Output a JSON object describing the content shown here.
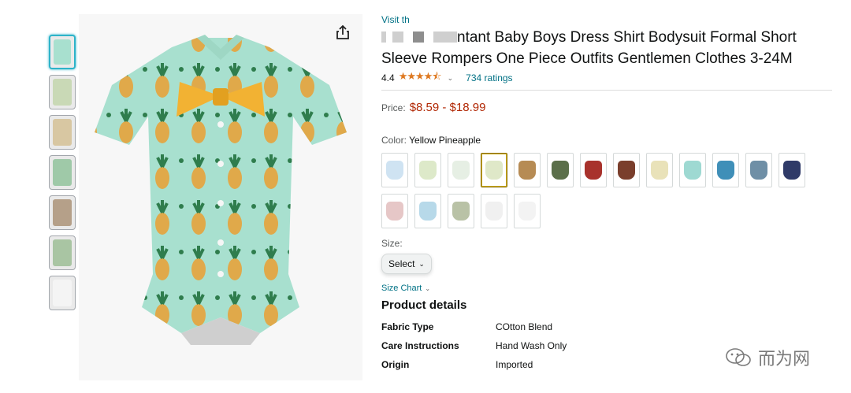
{
  "header": {
    "visit_link": "Visit th",
    "title_rest": "ntant Baby Boys Dress Shirt Bodysuit Formal Short Sleeve Rompers One Piece Outfits Gentlemen Clothes 3-24M"
  },
  "rating": {
    "value": "4.4",
    "stars": "★★★★⯪",
    "count": "734 ratings"
  },
  "price": {
    "label": "Price:",
    "value": "$8.59 - $18.99"
  },
  "color": {
    "label": "Color: ",
    "selected": "Yellow Pineapple",
    "swatch_colors": [
      "#cfe3f2",
      "#dde9c9",
      "#e6efe4",
      "#dfe8c8",
      "#b68b54",
      "#5b6f4a",
      "#a8322c",
      "#7a3e2c",
      "#e9e2b9",
      "#9ed9d2",
      "#3f8fb8",
      "#6f8fa6",
      "#2f3a68",
      "#e6c7c7",
      "#b7d9e9",
      "#b9c2a6",
      "#f0f0f0",
      "#f3f3f3"
    ]
  },
  "size": {
    "label": "Size:",
    "select": "Select"
  },
  "size_chart": "Size Chart",
  "details": {
    "title": "Product details",
    "rows": [
      {
        "k": "Fabric Type",
        "v": "COtton Blend"
      },
      {
        "k": "Care Instructions",
        "v": "Hand Wash Only"
      },
      {
        "k": "Origin",
        "v": "Imported"
      }
    ]
  },
  "watermark": "而为网",
  "colors": {
    "link": "#007185",
    "price": "#b12704",
    "star": "#de7921",
    "romper": "#a8e0cf",
    "bow": "#f2b233",
    "pineapple": "#e0a94a",
    "leaf": "#2f7d4d"
  }
}
